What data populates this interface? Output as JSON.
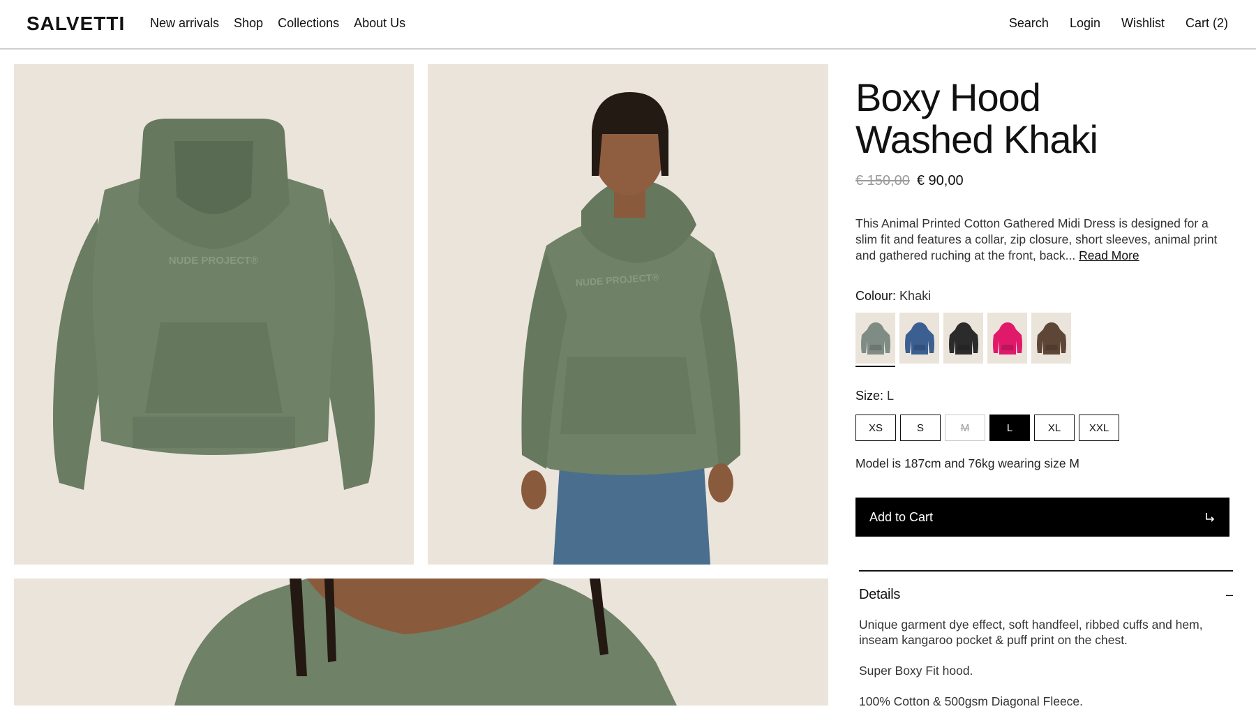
{
  "header": {
    "logo": "SALVETTI",
    "nav_left": [
      "New arrivals",
      "Shop",
      "Collections",
      "About Us"
    ],
    "nav_right": [
      "Search",
      "Login",
      "Wishlist",
      "Cart (2)"
    ]
  },
  "gallery": {
    "print_text": "NUDE PROJECT®"
  },
  "product": {
    "title_line1": "Boxy Hood",
    "title_line2": "Washed Khaki",
    "price_old": "€ 150,00",
    "price_new": "€ 90,00",
    "description": "This Animal Printed Cotton Gathered Midi Dress is designed for a slim fit and features a collar, zip closure, short sleeves, animal print and gathered ruching at the front, back...",
    "read_more": "Read More",
    "colour_label": "Colour:",
    "colour_value": "Khaki",
    "swatches": [
      {
        "name": "khaki",
        "color": "#7e8c84",
        "selected": true
      },
      {
        "name": "blue",
        "color": "#3b5f91",
        "selected": false
      },
      {
        "name": "black",
        "color": "#2b2b2b",
        "selected": false
      },
      {
        "name": "pink",
        "color": "#e0196b",
        "selected": false
      },
      {
        "name": "brown",
        "color": "#5e4637",
        "selected": false
      }
    ],
    "size_label": "Size:",
    "size_value": "L",
    "sizes": [
      "XS",
      "S",
      "M",
      "L",
      "XL",
      "XXL"
    ],
    "size_unavailable": "M",
    "size_selected": "L",
    "model_note": "Model is 187cm and 76kg wearing size M",
    "add_to_cart": "Add to Cart",
    "details_title": "Details",
    "details_paragraphs": [
      "Unique garment dye effect, soft handfeel, ribbed cuffs and hem, inseam kangaroo pocket & puff print on the chest.",
      "Super Boxy Fit hood.",
      "100% Cotton & 500gsm Diagonal Fleece."
    ]
  },
  "colors": {
    "accent": "#000000",
    "image_bg": "#ebe4da",
    "hoodie": "#6f8166"
  }
}
